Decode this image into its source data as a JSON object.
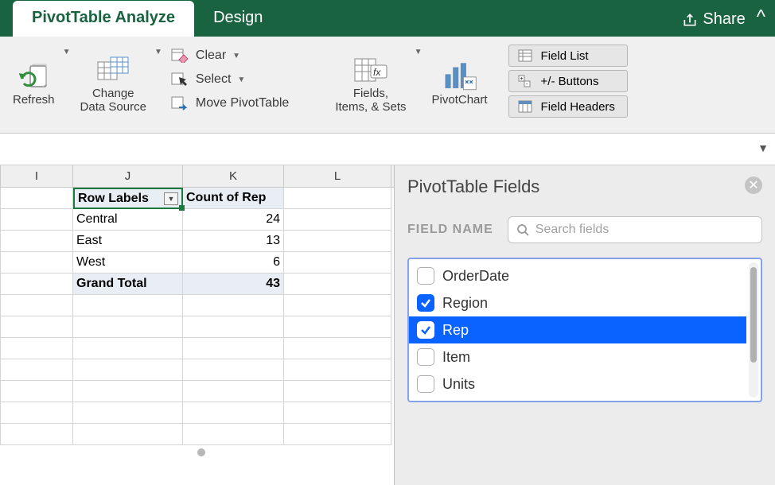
{
  "tabs": {
    "analyze": "PivotTable Analyze",
    "design": "Design"
  },
  "share": "Share",
  "ribbon": {
    "refresh": "Refresh",
    "change_ds": "Change\nData Source",
    "clear": "Clear",
    "select": "Select",
    "move": "Move PivotTable",
    "fields_sets": "Fields,\nItems, & Sets",
    "pivot_chart": "PivotChart",
    "field_list": "Field List",
    "pm_buttons": "+/- Buttons",
    "field_headers": "Field Headers"
  },
  "columns": {
    "i": "I",
    "j": "J",
    "k": "K",
    "l": "L"
  },
  "pivot": {
    "row_labels": "Row Labels",
    "count_col": "Count of Rep",
    "rows": [
      {
        "label": "Central",
        "value": "24"
      },
      {
        "label": "East",
        "value": "13"
      },
      {
        "label": "West",
        "value": "6"
      }
    ],
    "grand_total_label": "Grand Total",
    "grand_total_value": "43"
  },
  "pane": {
    "title": "PivotTable Fields",
    "field_name": "FIELD NAME",
    "search_placeholder": "Search fields",
    "fields": [
      {
        "name": "OrderDate",
        "checked": false,
        "selected": false
      },
      {
        "name": "Region",
        "checked": true,
        "selected": false
      },
      {
        "name": "Rep",
        "checked": true,
        "selected": true
      },
      {
        "name": "Item",
        "checked": false,
        "selected": false
      },
      {
        "name": "Units",
        "checked": false,
        "selected": false
      }
    ]
  }
}
